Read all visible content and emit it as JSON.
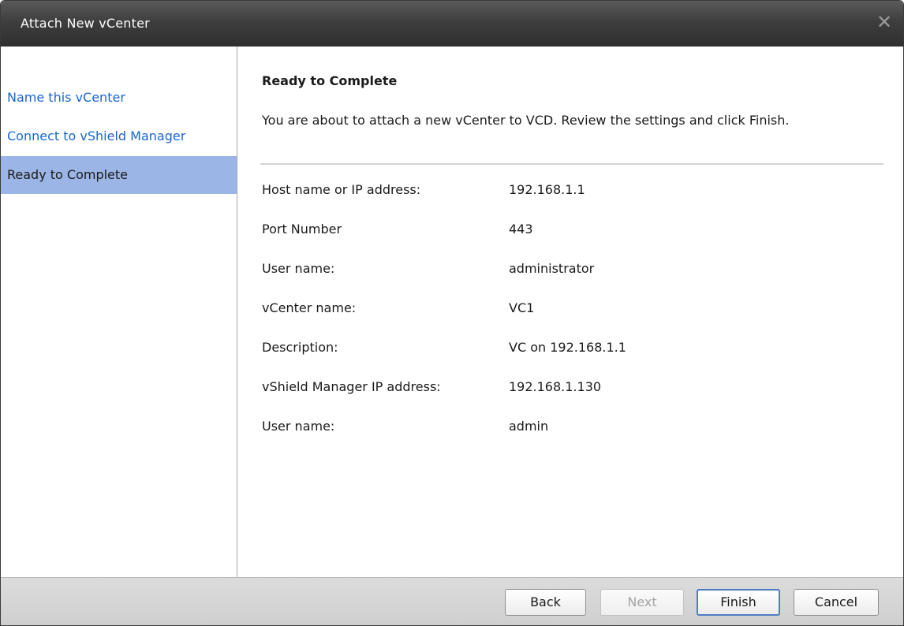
{
  "window": {
    "title": "Attach New vCenter",
    "close_glyph": "✕"
  },
  "sidebar": {
    "items": [
      {
        "label": "Name this vCenter",
        "active": false
      },
      {
        "label": "Connect to vShield Manager",
        "active": false
      },
      {
        "label": "Ready to Complete",
        "active": true
      }
    ]
  },
  "main": {
    "heading": "Ready to Complete",
    "intro": "You are about to attach a new vCenter to VCD. Review the settings and click Finish.",
    "settings": [
      {
        "label": "Host name or IP address:",
        "value": "192.168.1.1"
      },
      {
        "label": "Port Number",
        "value": "443"
      },
      {
        "label": "User name:",
        "value": "administrator"
      },
      {
        "label": "vCenter name:",
        "value": "VC1"
      },
      {
        "label": "Description:",
        "value": "VC on 192.168.1.1"
      },
      {
        "label": "vShield Manager IP address:",
        "value": "192.168.1.130"
      },
      {
        "label": "User name:",
        "value": "admin"
      }
    ]
  },
  "footer": {
    "back_label": "Back",
    "next_label": "Next",
    "finish_label": "Finish",
    "cancel_label": "Cancel"
  },
  "colors": {
    "link": "#1a66cc",
    "active_nav_bg": "#9bb6e6",
    "titlebar": "#3e3e3e",
    "primary_border": "#4f7bc4"
  }
}
